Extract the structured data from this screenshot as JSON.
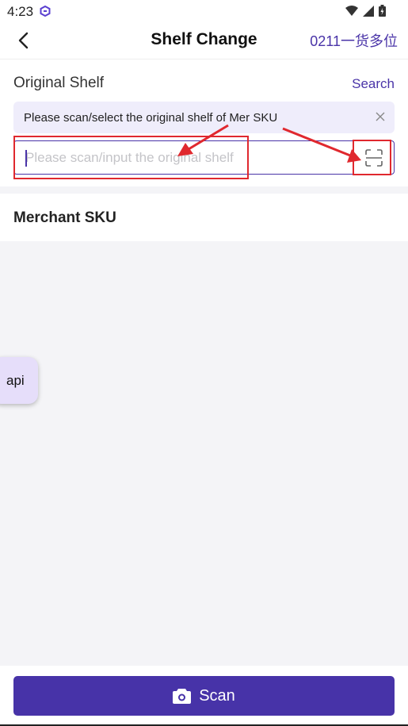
{
  "status_bar": {
    "time": "4:23",
    "icons": [
      "app-icon",
      "wifi-icon",
      "signal-icon",
      "battery-icon"
    ]
  },
  "header": {
    "title": "Shelf Change",
    "right_label": "0211一货多位",
    "back_icon": "chevron-left-icon"
  },
  "original_shelf": {
    "label": "Original Shelf",
    "search_label": "Search",
    "tip_text": "Please scan/select the original shelf of Mer SKU",
    "input_placeholder": "Please scan/input the original shelf",
    "input_value": "",
    "scan_icon": "scan-frame-icon"
  },
  "merchant_sku": {
    "title": "Merchant SKU"
  },
  "floating": {
    "label": "api"
  },
  "bottom": {
    "scan_label": "Scan",
    "camera_icon": "camera-icon"
  },
  "colors": {
    "accent": "#4733a8",
    "highlight": "#e0282e",
    "tip_bg": "#efedfb",
    "page_bg": "#f4f4f7"
  }
}
